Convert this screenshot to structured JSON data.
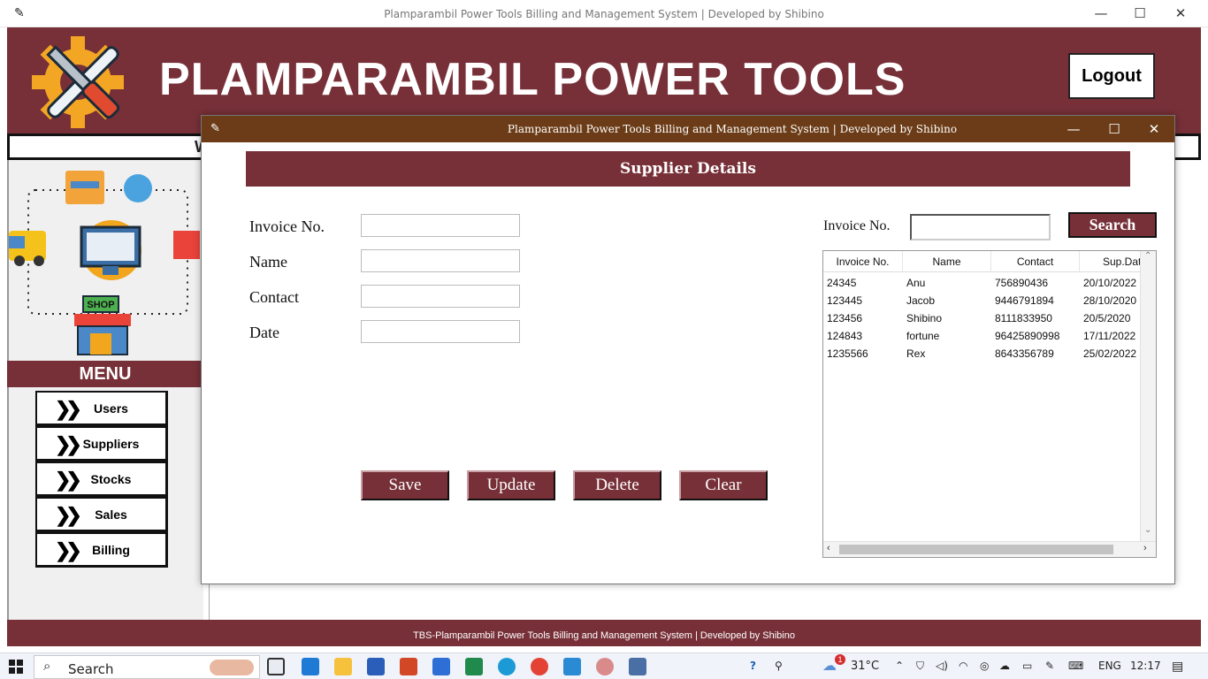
{
  "window": {
    "title": "Plamparambil Power Tools Billing and Management System |  Developed by Shibino",
    "minimize": "—",
    "maximize": "☐",
    "close": "✕"
  },
  "header": {
    "title": "PLAMPARAMBIL POWER TOOLS",
    "logout_label": "Logout",
    "subband_text": "W"
  },
  "menu": {
    "title": "MENU",
    "items": [
      {
        "label": "Users"
      },
      {
        "label": "Suppliers"
      },
      {
        "label": "Stocks"
      },
      {
        "label": "Sales"
      },
      {
        "label": "Billing"
      }
    ]
  },
  "dialog": {
    "title": "Plamparambil Power Tools Billing and Management System |  Developed by Shibino",
    "banner": "Supplier Details",
    "form": {
      "invoice_label": "Invoice No.",
      "name_label": "Name",
      "contact_label": "Contact",
      "date_label": "Date",
      "invoice_value": "",
      "name_value": "",
      "contact_value": "",
      "date_value": ""
    },
    "buttons": {
      "save": "Save",
      "update": "Update",
      "delete": "Delete",
      "clear": "Clear"
    },
    "search": {
      "label": "Invoice No.",
      "value": "",
      "button": "Search"
    },
    "table": {
      "columns": [
        "Invoice No.",
        "Name",
        "Contact",
        "Sup.Dat"
      ],
      "rows": [
        [
          "24345",
          "Anu",
          "756890436",
          "20/10/2022"
        ],
        [
          "123445",
          "Jacob",
          "9446791894",
          "28/10/2020"
        ],
        [
          "123456",
          "Shibino",
          "8111833950",
          "20/5/2020"
        ],
        [
          "124843",
          "fortune",
          "96425890998",
          "17/11/2022"
        ],
        [
          "1235566",
          "Rex",
          "8643356789",
          "25/02/2022"
        ]
      ]
    }
  },
  "footer": {
    "text": "TBS-Plamparambil Power Tools Billing and Management System |  Developed by Shibino"
  },
  "taskbar": {
    "search_label": "Search",
    "weather_temp": "31°C",
    "weather_badge": "1",
    "language": "ENG",
    "time": "12:17"
  }
}
